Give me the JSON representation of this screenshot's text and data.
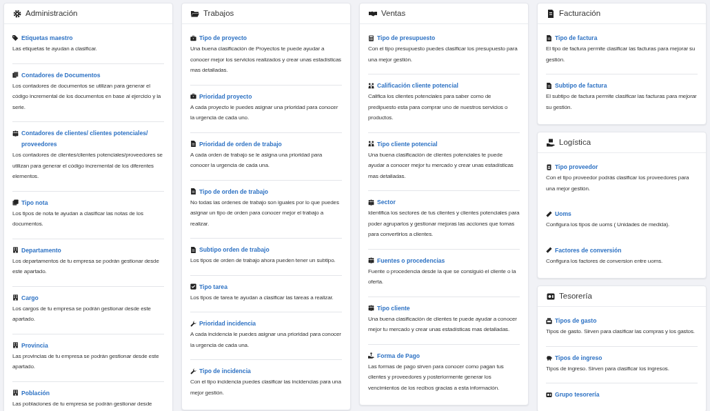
{
  "columns": [
    {
      "sections": [
        {
          "title": "Administración",
          "divided": true,
          "items": [
            {
              "title": "Etiquetas maestro",
              "description": "Las etiquetas te ayudan a clasificar."
            },
            {
              "title": "Contadores de Documentos",
              "description": "Los contadores de documentos se utilizan para generar el código incremental de los documentos en base al ejercicio y la serie."
            },
            {
              "title": "Contadores de clientes/ clientes potenciales/ proveedores",
              "description": "Los contadores de clientes/clientes potenciales/proveedores se utilizan para generar el código incremental de los diferentes elementos."
            },
            {
              "title": "Tipo nota",
              "description": "Los tipos de nota te ayudan a clasificar las notas de los documentos."
            },
            {
              "title": "Departamento",
              "description": "Los departamentos de tu empresa se podrán gestionar desde este apartado."
            },
            {
              "title": "Cargo",
              "description": "Los cargos de tu empresa se podrán gestionar desde este apartado."
            },
            {
              "title": "Provincia",
              "description": "Las provincias de tu empresa se podrán gestionar desde este apartado."
            },
            {
              "title": "Población",
              "description": "Las poblaciones de tu empresa se podrán gestionar desde"
            }
          ]
        }
      ]
    },
    {
      "sections": [
        {
          "title": "Trabajos",
          "divided": true,
          "items": [
            {
              "title": "Tipo de proyecto",
              "description": "Una buena clasificación de Proyectos te puede ayudar a conocer mejor los servicios realizados y crear unas estadísticas mas detalladas."
            },
            {
              "title": "Prioridad proyecto",
              "description": "A cada proyecto le puedes asignar una prioridad para conocer la urgencia de cada uno."
            },
            {
              "title": "Prioridad de orden de trabajo",
              "description": "A cada orden de trabajo se le asigna una prioridad para conocer la urgencia de cada una."
            },
            {
              "title": "Tipo de orden de trabajo",
              "description": "No todas las ordenes de trabajo son iguales por lo que puedes asignar un tipo de orden para conocer mejor el trabajo a realizar."
            },
            {
              "title": "Subtipo orden de trabajo",
              "description": "Los tipos de orden de trabajo ahora pueden tener un subtipo."
            },
            {
              "title": "Tipo tarea",
              "description": "Los tipos de tarea te ayudan a clasificar las tareas a realizar."
            },
            {
              "title": "Prioridad incidencia",
              "description": "A cada incidencia le puedes asignar una prioridad para conocer la urgencia de cada una."
            },
            {
              "title": "Tipo de incidencia",
              "description": "Con el tipo incidencia puedes clasificar las incidencias para una mejor gestión."
            }
          ]
        }
      ]
    },
    {
      "sections": [
        {
          "title": "Ventas",
          "divided": true,
          "items": [
            {
              "title": "Tipo de presupuesto",
              "description": "Con el tipo presupuesto puedes clasificar los presupuesto para una mejor gestión."
            },
            {
              "title": "Calificación cliente potencial",
              "description": "Califica los clientes potenciales para saber como de predipuesto esta para comprar uno de nuestros servicios o productos."
            },
            {
              "title": "Tipo cliente potencial",
              "description": "Una buena clasificación de clientes potenciales te puede ayudar a conocer mejor tu mercado y crear unas estadísticas mas detalladas."
            },
            {
              "title": "Sector",
              "description": "Identifica los sectores de tus clientes y clientes potenciales para poder agruparlos y gestionar mejoras las acciones que tomas para convertirlos a clientes."
            },
            {
              "title": "Fuentes o procedencias",
              "description": "Fuente o procedencia desde la que se consiguió el cliente o la oferta."
            },
            {
              "title": "Tipo cliente",
              "description": "Una buena clasificación de clientes te puede ayudar a conocer mejor tu mercado y crear unas estadísticas mas detalladas."
            },
            {
              "title": "Forma de Pago",
              "description": "Las formas de pago sirven para conocer como pagan tus clientes y proveedores y posteriormente generar los vencimientos de los recibos gracias a esta información."
            }
          ]
        }
      ]
    },
    {
      "sections": [
        {
          "title": "Facturación",
          "divided": true,
          "items": [
            {
              "title": "Tipo de factura",
              "description": "El tipo de factura permite clasificar las facturas para mejorar su gestión."
            },
            {
              "title": "Subtipo de factura",
              "description": "El subtipo de factura permite clasificar las facturas para mejorar su gestión."
            }
          ]
        },
        {
          "title": "Logística",
          "divided": false,
          "items": [
            {
              "title": "Tipo proveedor",
              "description": "Con el tipo proveedor podrás clasificar los proveedores para una mejor gestión."
            },
            {
              "title": "Uoms",
              "description": "Configura los tipos de uoms ( Unidades de medida)."
            },
            {
              "title": "Factores de conversión",
              "description": "Configura los factores de conversion entre uoms."
            }
          ]
        },
        {
          "title": "Tesorería",
          "divided": true,
          "items": [
            {
              "title": "Tipos de gasto",
              "description": "Tipos de gasto. Sirven para clasificar las compras y los gastos."
            },
            {
              "title": "Tipos de ingreso",
              "description": "Tipos de ingreso. Sirven para clasificar los ingresos."
            },
            {
              "title": "Grupo tesorería"
            }
          ]
        }
      ]
    }
  ]
}
